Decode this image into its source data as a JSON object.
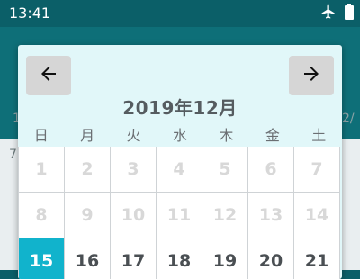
{
  "status_bar": {
    "time": "13:41",
    "icons": [
      "airplane-icon",
      "battery-icon"
    ]
  },
  "background": {
    "left_hint": "1",
    "right_hint": "2/",
    "row_hint": "7"
  },
  "calendar": {
    "month_title": "2019年12月",
    "weekdays": [
      "日",
      "月",
      "火",
      "水",
      "木",
      "金",
      "土"
    ],
    "rows": [
      [
        {
          "day": "1",
          "state": "muted"
        },
        {
          "day": "2",
          "state": "muted"
        },
        {
          "day": "3",
          "state": "muted"
        },
        {
          "day": "4",
          "state": "muted"
        },
        {
          "day": "5",
          "state": "muted"
        },
        {
          "day": "6",
          "state": "muted"
        },
        {
          "day": "7",
          "state": "muted"
        }
      ],
      [
        {
          "day": "8",
          "state": "muted"
        },
        {
          "day": "9",
          "state": "muted"
        },
        {
          "day": "10",
          "state": "muted"
        },
        {
          "day": "11",
          "state": "muted"
        },
        {
          "day": "12",
          "state": "muted"
        },
        {
          "day": "13",
          "state": "muted"
        },
        {
          "day": "14",
          "state": "muted"
        }
      ],
      [
        {
          "day": "15",
          "state": "selected"
        },
        {
          "day": "16",
          "state": "current"
        },
        {
          "day": "17",
          "state": "current"
        },
        {
          "day": "18",
          "state": "current"
        },
        {
          "day": "19",
          "state": "current"
        },
        {
          "day": "20",
          "state": "current"
        },
        {
          "day": "21",
          "state": "current"
        }
      ]
    ],
    "nav": {
      "prev_icon": "arrow-left-icon",
      "next_icon": "arrow-right-icon"
    },
    "colors": {
      "selected": "#11b3cc",
      "dialog_bg": "#e1f7f9",
      "statusbar_bg": "#0b5f68"
    }
  }
}
